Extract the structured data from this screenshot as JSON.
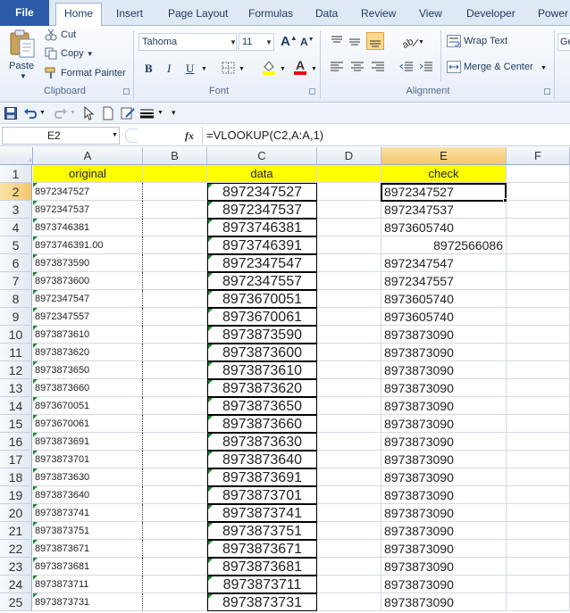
{
  "ribbon_tabs": [
    "File",
    "Home",
    "Insert",
    "Page Layout",
    "Formulas",
    "Data",
    "Review",
    "View",
    "Developer",
    "Power"
  ],
  "clipboard": {
    "paste": "Paste",
    "cut": "Cut",
    "copy": "Copy",
    "format_painter": "Format Painter",
    "label": "Clipboard"
  },
  "font": {
    "name": "Tahoma",
    "size": "11",
    "bold": "B",
    "italic": "I",
    "underline": "U",
    "label": "Font",
    "grow": "A",
    "shrink": "A"
  },
  "alignment": {
    "wrap_text": "Wrap Text",
    "merge_center": "Merge & Center",
    "label": "Alignment"
  },
  "cut_off_box": "Ge",
  "name_box": "E2",
  "fx": "fx",
  "formula": "=VLOOKUP(C2,A:A,1)",
  "columns": [
    "A",
    "B",
    "C",
    "D",
    "E",
    "F"
  ],
  "selected_column": "E",
  "selected_row": "2",
  "header_row": {
    "row": "1",
    "A": "original",
    "C": "data",
    "E": "check"
  },
  "rows": [
    {
      "n": "2",
      "A": "8972347527",
      "C": "8972347527",
      "E": "8972347527"
    },
    {
      "n": "3",
      "A": "8972347537",
      "C": "8972347537",
      "E": "8972347537"
    },
    {
      "n": "4",
      "A": "8973746381",
      "C": "8973746381",
      "E": "8973605740"
    },
    {
      "n": "5",
      "A": "8973746391.00",
      "C": "8973746391",
      "E": "8972566086"
    },
    {
      "n": "6",
      "A": "8973873590",
      "C": "8972347547",
      "E": "8972347547"
    },
    {
      "n": "7",
      "A": "8973873600",
      "C": "8972347557",
      "E": "8972347557"
    },
    {
      "n": "8",
      "A": "8972347547",
      "C": "8973670051",
      "E": "8973605740"
    },
    {
      "n": "9",
      "A": "8972347557",
      "C": "8973670061",
      "E": "8973605740"
    },
    {
      "n": "10",
      "A": "8973873610",
      "C": "8973873590",
      "E": "8973873090"
    },
    {
      "n": "11",
      "A": "8973873620",
      "C": "8973873600",
      "E": "8973873090"
    },
    {
      "n": "12",
      "A": "8973873650",
      "C": "8973873610",
      "E": "8973873090"
    },
    {
      "n": "13",
      "A": "8973873660",
      "C": "8973873620",
      "E": "8973873090"
    },
    {
      "n": "14",
      "A": "8973670051",
      "C": "8973873650",
      "E": "8973873090"
    },
    {
      "n": "15",
      "A": "8973670061",
      "C": "8973873660",
      "E": "8973873090"
    },
    {
      "n": "16",
      "A": "8973873691",
      "C": "8973873630",
      "E": "8973873090"
    },
    {
      "n": "17",
      "A": "8973873701",
      "C": "8973873640",
      "E": "8973873090"
    },
    {
      "n": "18",
      "A": "8973873630",
      "C": "8973873691",
      "E": "8973873090"
    },
    {
      "n": "19",
      "A": "8973873640",
      "C": "8973873701",
      "E": "8973873090"
    },
    {
      "n": "20",
      "A": "8973873741",
      "C": "8973873741",
      "E": "8973873090"
    },
    {
      "n": "21",
      "A": "8973873751",
      "C": "8973873751",
      "E": "8973873090"
    },
    {
      "n": "22",
      "A": "8973873671",
      "C": "8973873671",
      "E": "8973873090"
    },
    {
      "n": "23",
      "A": "8973873681",
      "C": "8973873681",
      "E": "8973873090"
    },
    {
      "n": "24",
      "A": "8973873711",
      "C": "8973873711",
      "E": "8973873090"
    },
    {
      "n": "25",
      "A": "8973873731",
      "C": "8973873731",
      "E": "8973873090"
    }
  ],
  "colors": {
    "header_fill": "#ffff00",
    "selection": "#000000",
    "file_tab": "#2a5aa8"
  }
}
